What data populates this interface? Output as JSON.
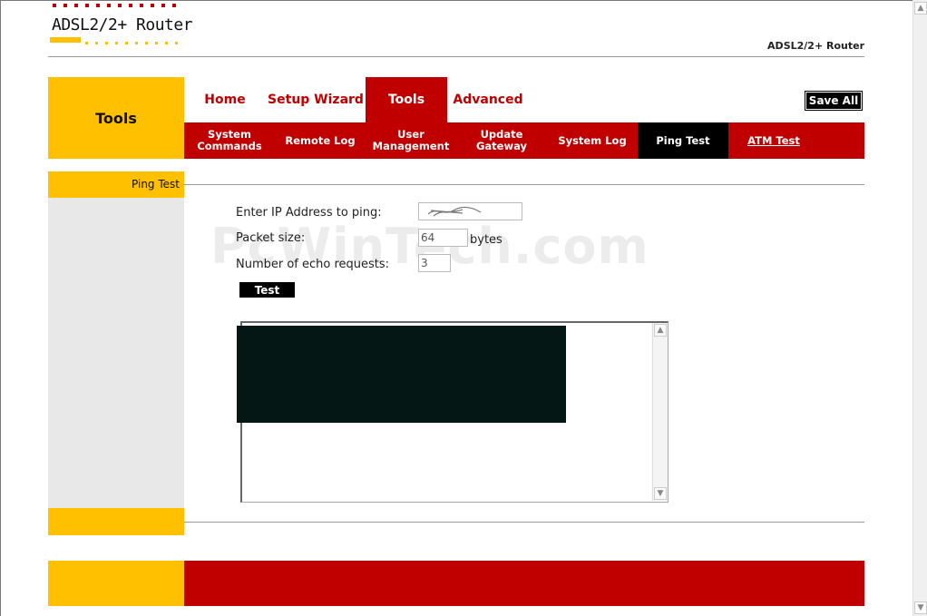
{
  "logo": {
    "text": "ADSL2/2+ Router"
  },
  "header": {
    "product_name": "ADSL2/2+ Router"
  },
  "section_title": "Tools",
  "main_tabs": [
    {
      "label": "Home"
    },
    {
      "label": "Setup Wizard"
    },
    {
      "label": "Tools"
    },
    {
      "label": "Advanced"
    }
  ],
  "save_all_label": "Save All",
  "sub_tabs": [
    {
      "label": "System Commands"
    },
    {
      "label": "Remote Log"
    },
    {
      "label": "User Management"
    },
    {
      "label": "Update Gateway"
    },
    {
      "label": "System Log"
    },
    {
      "label": "Ping Test"
    },
    {
      "label": "ATM Test"
    }
  ],
  "sidebar": {
    "page_label": "Ping Test"
  },
  "form": {
    "ip_label": "Enter IP Address to ping:",
    "ip_value": "",
    "packet_size_label": "Packet size:",
    "packet_size_value": "64",
    "packet_size_unit": "bytes",
    "echo_label": "Number of echo requests:",
    "echo_value": "3",
    "test_button": "Test"
  },
  "watermark": "PcWinTech.com",
  "colors": {
    "accent_red": "#c00000",
    "accent_yellow": "#ffc000"
  }
}
